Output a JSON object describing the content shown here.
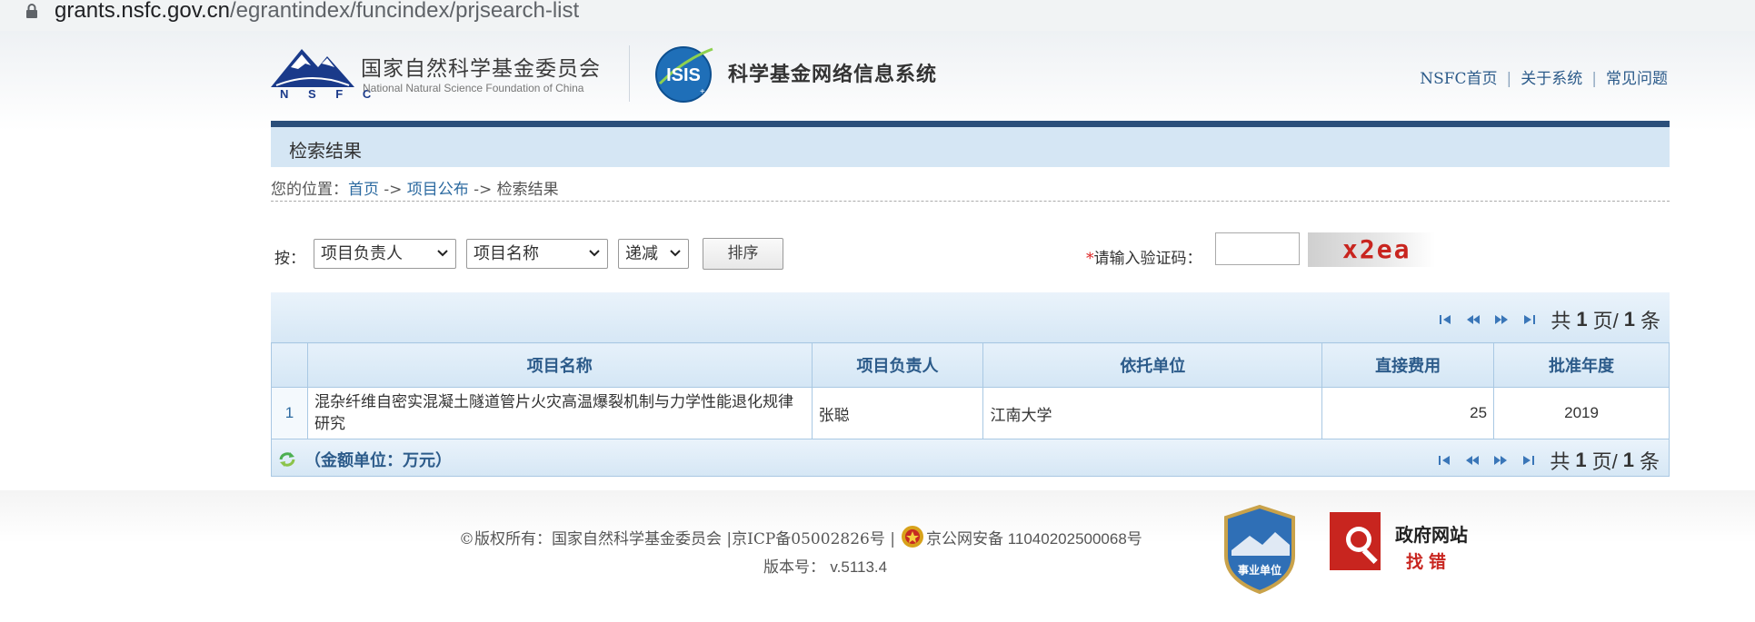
{
  "browser": {
    "url_host": "grants.nsfc.gov.cn",
    "url_path": "/egrantindex/funcindex/prjsearch-list"
  },
  "header": {
    "logo_letters": "N S F C",
    "org_name_cn": "国家自然科学基金委员会",
    "org_name_en": "National Natural Science Foundation of China",
    "system_name": "科学基金网络信息系统",
    "links": [
      "NSFC首页",
      "关于系统",
      "常见问题"
    ]
  },
  "title_bar": {
    "title": "检索结果"
  },
  "breadcrumb": {
    "prefix": "您的位置：",
    "items": [
      "首页",
      "项目公布",
      "检索结果"
    ],
    "separator": " -> "
  },
  "search": {
    "by_label": "按：",
    "select1": "项目负责人",
    "select2": "项目名称",
    "select3": "递减",
    "sort_button": "排序",
    "captcha_star": "*",
    "captcha_label": "请输入验证码：",
    "captcha_input": "",
    "captcha_text": "x2ea"
  },
  "pager": {
    "prefix": "共",
    "current": "1",
    "mid": "页/",
    "total": "1",
    "suffix": "条"
  },
  "table": {
    "headers": [
      "项目名称",
      "项目负责人",
      "依托单位",
      "直接费用",
      "批准年度"
    ],
    "rows": [
      {
        "index": "1",
        "name": "混杂纤维自密实混凝土隧道管片火灾高温爆裂机制与力学性能退化规律研究",
        "leader": "张聪",
        "institution": "江南大学",
        "cost": "25",
        "year": "2019"
      }
    ]
  },
  "amount_unit": "（金额单位：万元）",
  "footer": {
    "copyright": "©版权所有：国家自然科学基金委员会 | ",
    "icp": "京ICP备05002826号 | ",
    "police": "京公网安备 11040202500068号",
    "version_label": "版本号：",
    "version": "v.5113.4",
    "badge1_text": "事业单位",
    "badge2_title": "政府网站",
    "badge2_sub": "找错"
  },
  "colors": {
    "link": "#2c6aa0",
    "header_blue": "#2b4f7a",
    "table_header": "#2c5b8a",
    "captcha_red": "#c8251f"
  }
}
